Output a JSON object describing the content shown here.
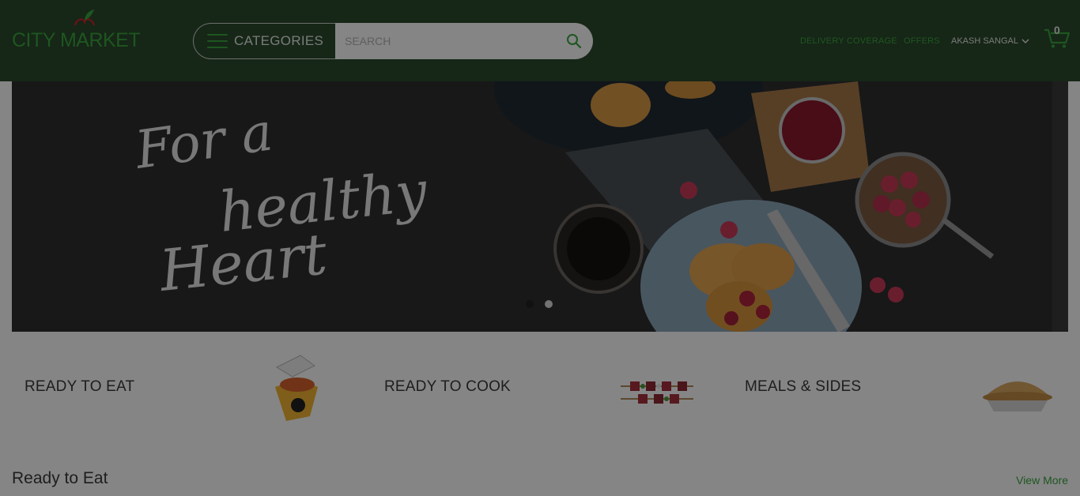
{
  "brand": {
    "name": "CITY MARKET",
    "accent_color": "#3aa53f",
    "header_color": "#2b4a2c"
  },
  "header": {
    "categories_label": "CATEGORIES",
    "search_placeholder": "SEARCH",
    "search_value": "",
    "nav": {
      "delivery": "DELIVERY COVERAGE",
      "offers": "OFFERS"
    },
    "user_name": "AKASH SANGAL",
    "cart_count": "0",
    "icons": [
      "hamburger-icon",
      "search-icon",
      "chevron-down-icon",
      "cart-icon",
      "apple-leaf-logo"
    ]
  },
  "hero": {
    "headline_line1": "For a",
    "headline_line2": "healthy",
    "headline_line3": "Heart",
    "slides": 2,
    "active_slide": 1
  },
  "categories": [
    {
      "label": "READY TO EAT",
      "image": "noodle-box"
    },
    {
      "label": "READY TO COOK",
      "image": "kebab-skewers"
    },
    {
      "label": "MEALS & SIDES",
      "image": "pie"
    }
  ],
  "section": {
    "title": "Ready to Eat",
    "view_more": "View More"
  }
}
